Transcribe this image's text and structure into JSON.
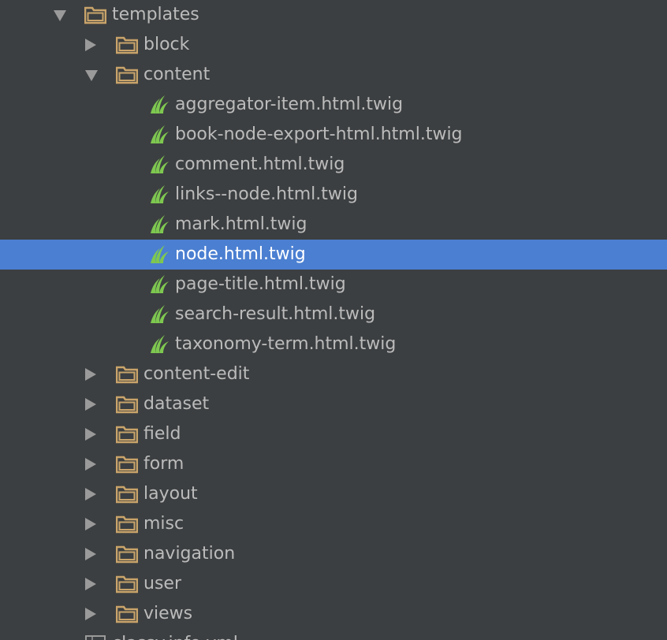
{
  "tree": {
    "nodes": [
      {
        "label": "templates",
        "depth": 0,
        "type": "folder",
        "expanded": true
      },
      {
        "label": "block",
        "depth": 1,
        "type": "folder",
        "expanded": false
      },
      {
        "label": "content",
        "depth": 1,
        "type": "folder",
        "expanded": true
      },
      {
        "label": "aggregator-item.html.twig",
        "depth": 2,
        "type": "twig"
      },
      {
        "label": "book-node-export-html.html.twig",
        "depth": 2,
        "type": "twig"
      },
      {
        "label": "comment.html.twig",
        "depth": 2,
        "type": "twig"
      },
      {
        "label": "links--node.html.twig",
        "depth": 2,
        "type": "twig"
      },
      {
        "label": "mark.html.twig",
        "depth": 2,
        "type": "twig"
      },
      {
        "label": "node.html.twig",
        "depth": 2,
        "type": "twig",
        "selected": true
      },
      {
        "label": "page-title.html.twig",
        "depth": 2,
        "type": "twig"
      },
      {
        "label": "search-result.html.twig",
        "depth": 2,
        "type": "twig"
      },
      {
        "label": "taxonomy-term.html.twig",
        "depth": 2,
        "type": "twig"
      },
      {
        "label": "content-edit",
        "depth": 1,
        "type": "folder",
        "expanded": false
      },
      {
        "label": "dataset",
        "depth": 1,
        "type": "folder",
        "expanded": false
      },
      {
        "label": "field",
        "depth": 1,
        "type": "folder",
        "expanded": false
      },
      {
        "label": "form",
        "depth": 1,
        "type": "folder",
        "expanded": false
      },
      {
        "label": "layout",
        "depth": 1,
        "type": "folder",
        "expanded": false
      },
      {
        "label": "misc",
        "depth": 1,
        "type": "folder",
        "expanded": false
      },
      {
        "label": "navigation",
        "depth": 1,
        "type": "folder",
        "expanded": false
      },
      {
        "label": "user",
        "depth": 1,
        "type": "folder",
        "expanded": false
      },
      {
        "label": "views",
        "depth": 1,
        "type": "folder",
        "expanded": false
      },
      {
        "label": "classy.info.yml",
        "depth": 0,
        "type": "file"
      }
    ]
  },
  "colors": {
    "background": "#3c3f41",
    "text": "#bbbbbb",
    "selection": "#4b7fd1",
    "selected_text": "#ffffff",
    "folder": "#c9a46a",
    "twig": "#7ec850",
    "arrow": "#9a9a9a"
  }
}
